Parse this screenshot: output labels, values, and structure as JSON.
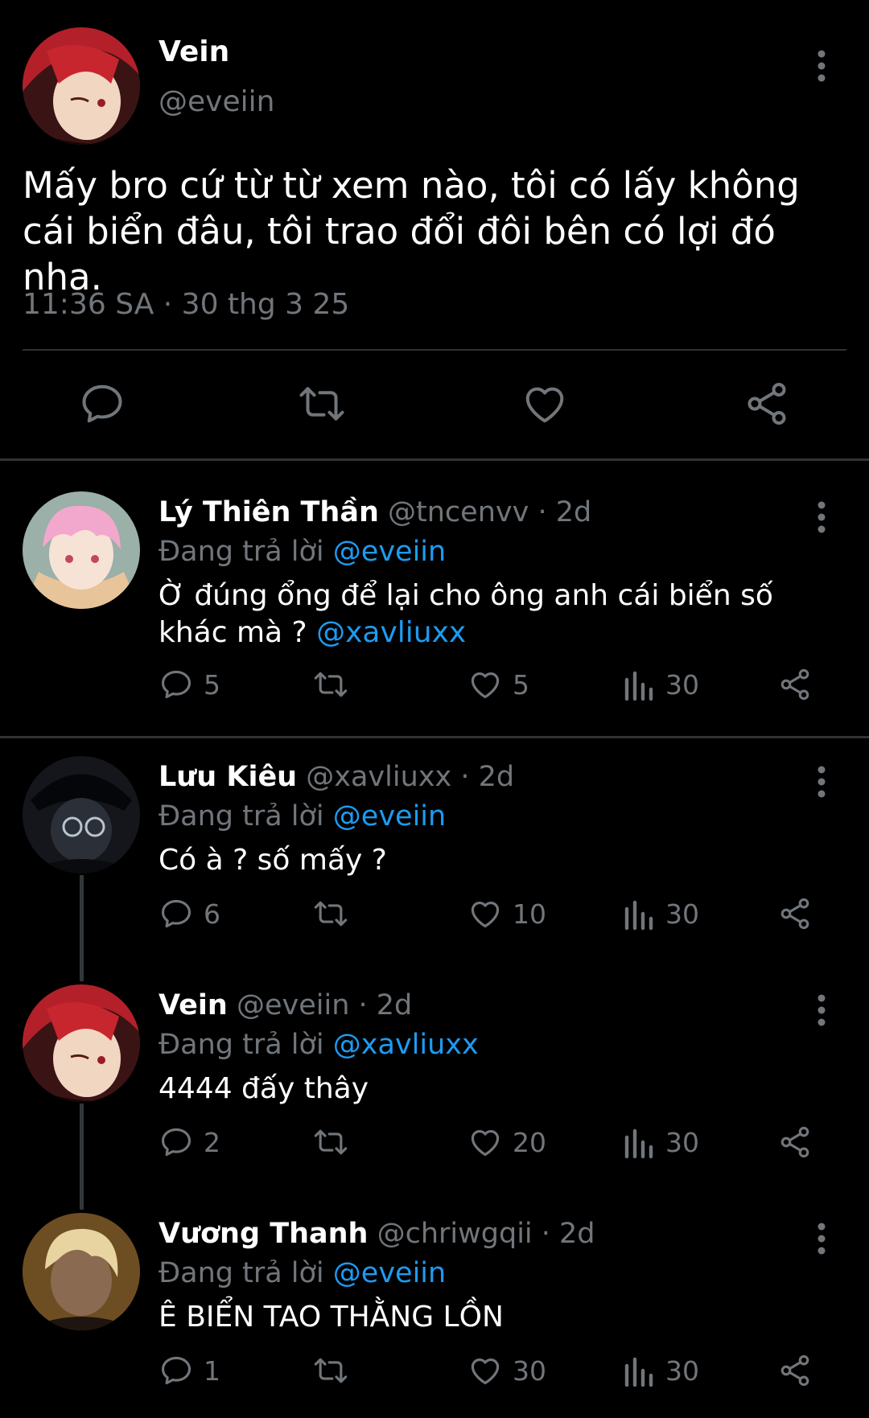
{
  "main_tweet": {
    "name": "Vein",
    "handle": "@eveiin",
    "text": "Mấy bro cứ từ từ xem nào, tôi có lấy không cái biển đâu, tôi trao đổi đôi bên có lợi đó nha.",
    "timestamp": "11:36 SA · 30 thg 3 25",
    "actions": [
      "reply-icon",
      "retweet-icon",
      "like-icon",
      "share-icon"
    ]
  },
  "replies": [
    {
      "name": "Lý Thiên Thần",
      "handle": "@tncenvv",
      "time": "· 2d",
      "replying_label": "Đang trả lời",
      "replying_to": "@eveiin",
      "text": "Ờ đúng ổng để lại cho ông anh cái biển số khác mà ?",
      "mention": "@xavliuxx",
      "replies": "5",
      "retweets": "",
      "likes": "5",
      "views": "30"
    },
    {
      "name": "Lưu Kiêu",
      "handle": "@xavliuxx",
      "time": "· 2d",
      "replying_label": "Đang trả lời",
      "replying_to": "@eveiin",
      "text": "Có à ? số mấy ?",
      "mention": "",
      "replies": "6",
      "retweets": "",
      "likes": "10",
      "views": "30"
    },
    {
      "name": "Vein",
      "handle": "@eveiin",
      "time": "· 2d",
      "replying_label": "Đang trả lời",
      "replying_to": "@xavliuxx",
      "text": "4444 đấy thây",
      "mention": "",
      "replies": "2",
      "retweets": "",
      "likes": "20",
      "views": "30"
    },
    {
      "name": "Vương Thanh",
      "handle": "@chriwgqii",
      "time": "· 2d",
      "replying_label": "Đang trả lời",
      "replying_to": "@eveiin",
      "text": "Ê BIỂN TAO THẰNG LỒN",
      "mention": "",
      "replies": "1",
      "retweets": "",
      "likes": "30",
      "views": "30"
    }
  ],
  "colors": {
    "background": "#000000",
    "text": "#e7e9ea",
    "secondary": "#71767b",
    "link": "#1d9bf0",
    "divider": "#2f3336"
  }
}
